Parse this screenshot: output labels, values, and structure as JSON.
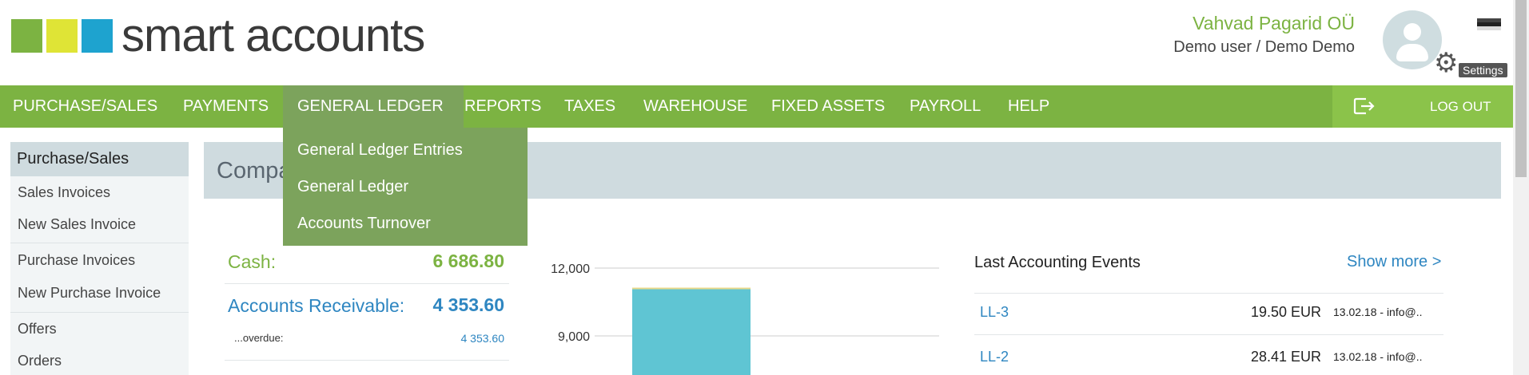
{
  "brand": {
    "name": "smart accounts",
    "colors": [
      "#7cb342",
      "#dfe436",
      "#1ea3cf"
    ]
  },
  "header": {
    "company": "Vahvad Pagarid OÜ",
    "user": "Demo user / Demo Demo",
    "settings_tooltip": "Settings",
    "avatar_icon": "user-avatar-icon",
    "settings_icon": "gear-icon"
  },
  "nav": {
    "items": [
      "PURCHASE/SALES",
      "PAYMENTS",
      "GENERAL LEDGER",
      "REPORTS",
      "TAXES",
      "WAREHOUSE",
      "FIXED ASSETS",
      "PAYROLL",
      "HELP"
    ],
    "active": "GENERAL LEDGER",
    "logout_label": "LOG OUT",
    "logout_icon": "logout-icon",
    "accent": "#7cb342"
  },
  "dropdown": {
    "items": [
      "General Ledger Entries",
      "General Ledger",
      "Accounts Turnover"
    ]
  },
  "sidebar": {
    "title": "Purchase/Sales",
    "items": [
      "Sales Invoices",
      "New Sales Invoice",
      "Purchase Invoices",
      "New Purchase Invoice",
      "Offers",
      "Orders"
    ]
  },
  "main": {
    "title": "Compa"
  },
  "summary": {
    "cash_label": "Cash:",
    "cash_value": "6 686.80",
    "ar_label": "Accounts Receivable:",
    "ar_value": "4 353.60",
    "overdue_label": "...overdue:",
    "overdue_value": "4 353.60"
  },
  "chart_data": {
    "type": "bar",
    "y_ticks": [
      "12,000",
      "9,000"
    ],
    "series": [
      {
        "values": [
          11100
        ],
        "color": "#5fc5d3"
      }
    ],
    "ylim_visible": [
      7500,
      12000
    ]
  },
  "events": {
    "title": "Last Accounting Events",
    "show_more": "Show more >",
    "rows": [
      {
        "id": "LL-3",
        "amount": "19.50 EUR",
        "meta": "13.02.18 - info@.."
      },
      {
        "id": "LL-2",
        "amount": "28.41 EUR",
        "meta": "13.02.18 - info@.."
      }
    ]
  }
}
